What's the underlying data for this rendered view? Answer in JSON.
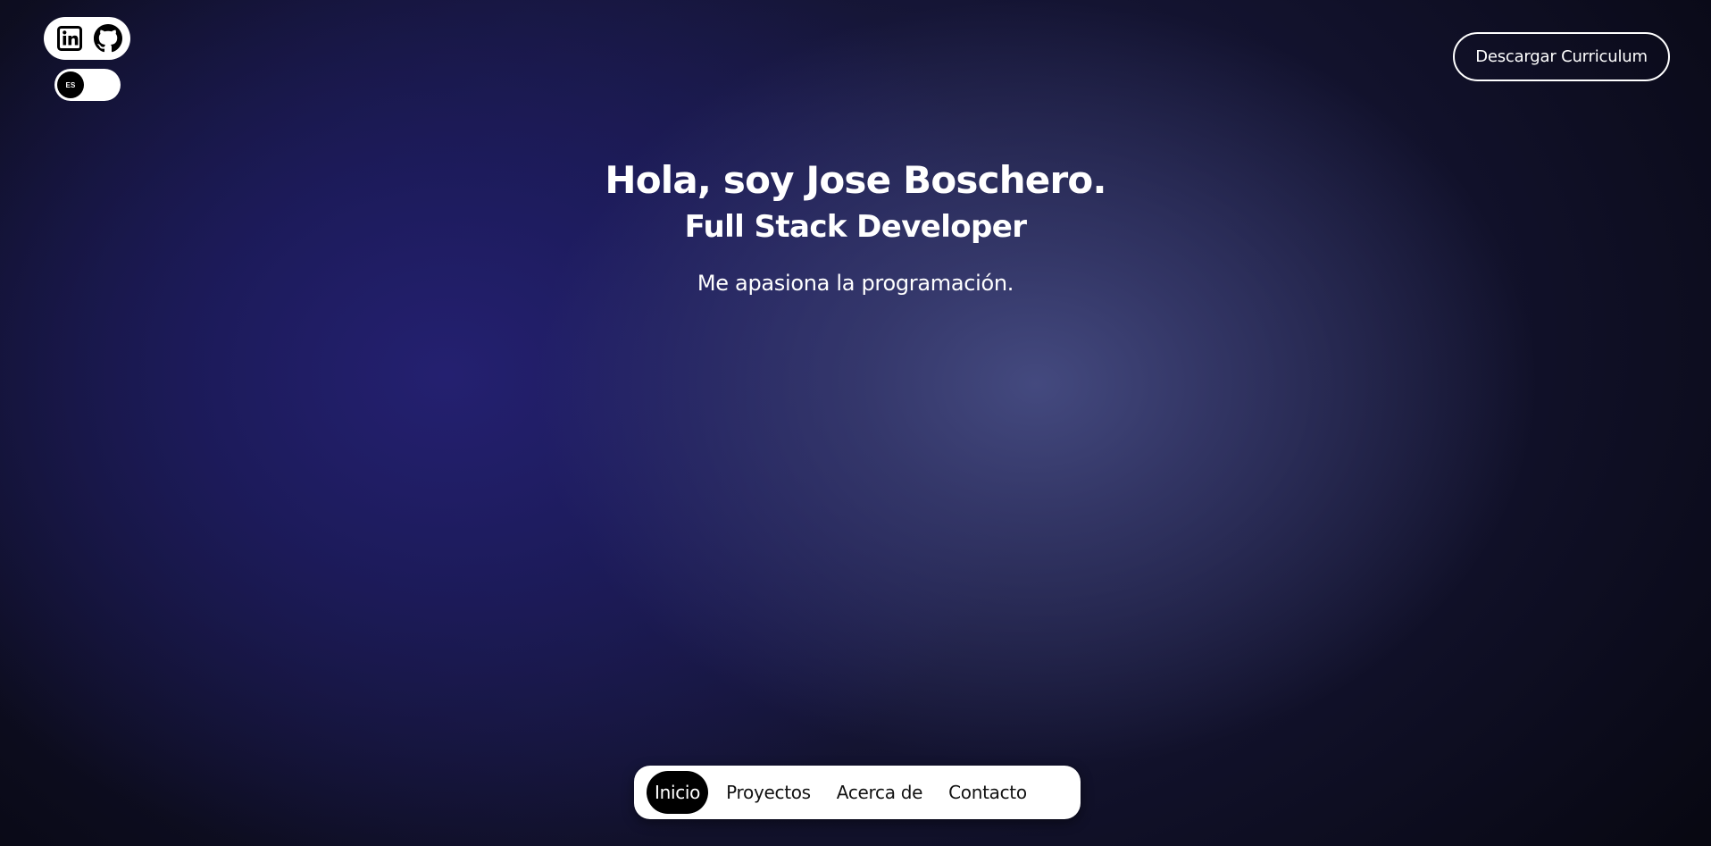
{
  "social": {
    "linkedin_icon": "linkedin-icon",
    "github_icon": "github-icon"
  },
  "language_toggle": {
    "label": "ES"
  },
  "header": {
    "cv_button_label": "Descargar Curriculum"
  },
  "hero": {
    "title": "Hola, soy Jose Boschero.",
    "subtitle": "Full Stack Developer",
    "tagline": "Me apasiona la programación."
  },
  "nav": {
    "items": [
      {
        "label": "Inicio",
        "active": true
      },
      {
        "label": "Proyectos",
        "active": false
      },
      {
        "label": "Acerca de",
        "active": false
      },
      {
        "label": "Contacto",
        "active": false
      }
    ]
  },
  "colors": {
    "background_dark": "#07070f",
    "background_blue": "#242070",
    "background_highlight": "#464c82",
    "foreground": "#ffffff",
    "nav_active_bg": "#000000"
  }
}
